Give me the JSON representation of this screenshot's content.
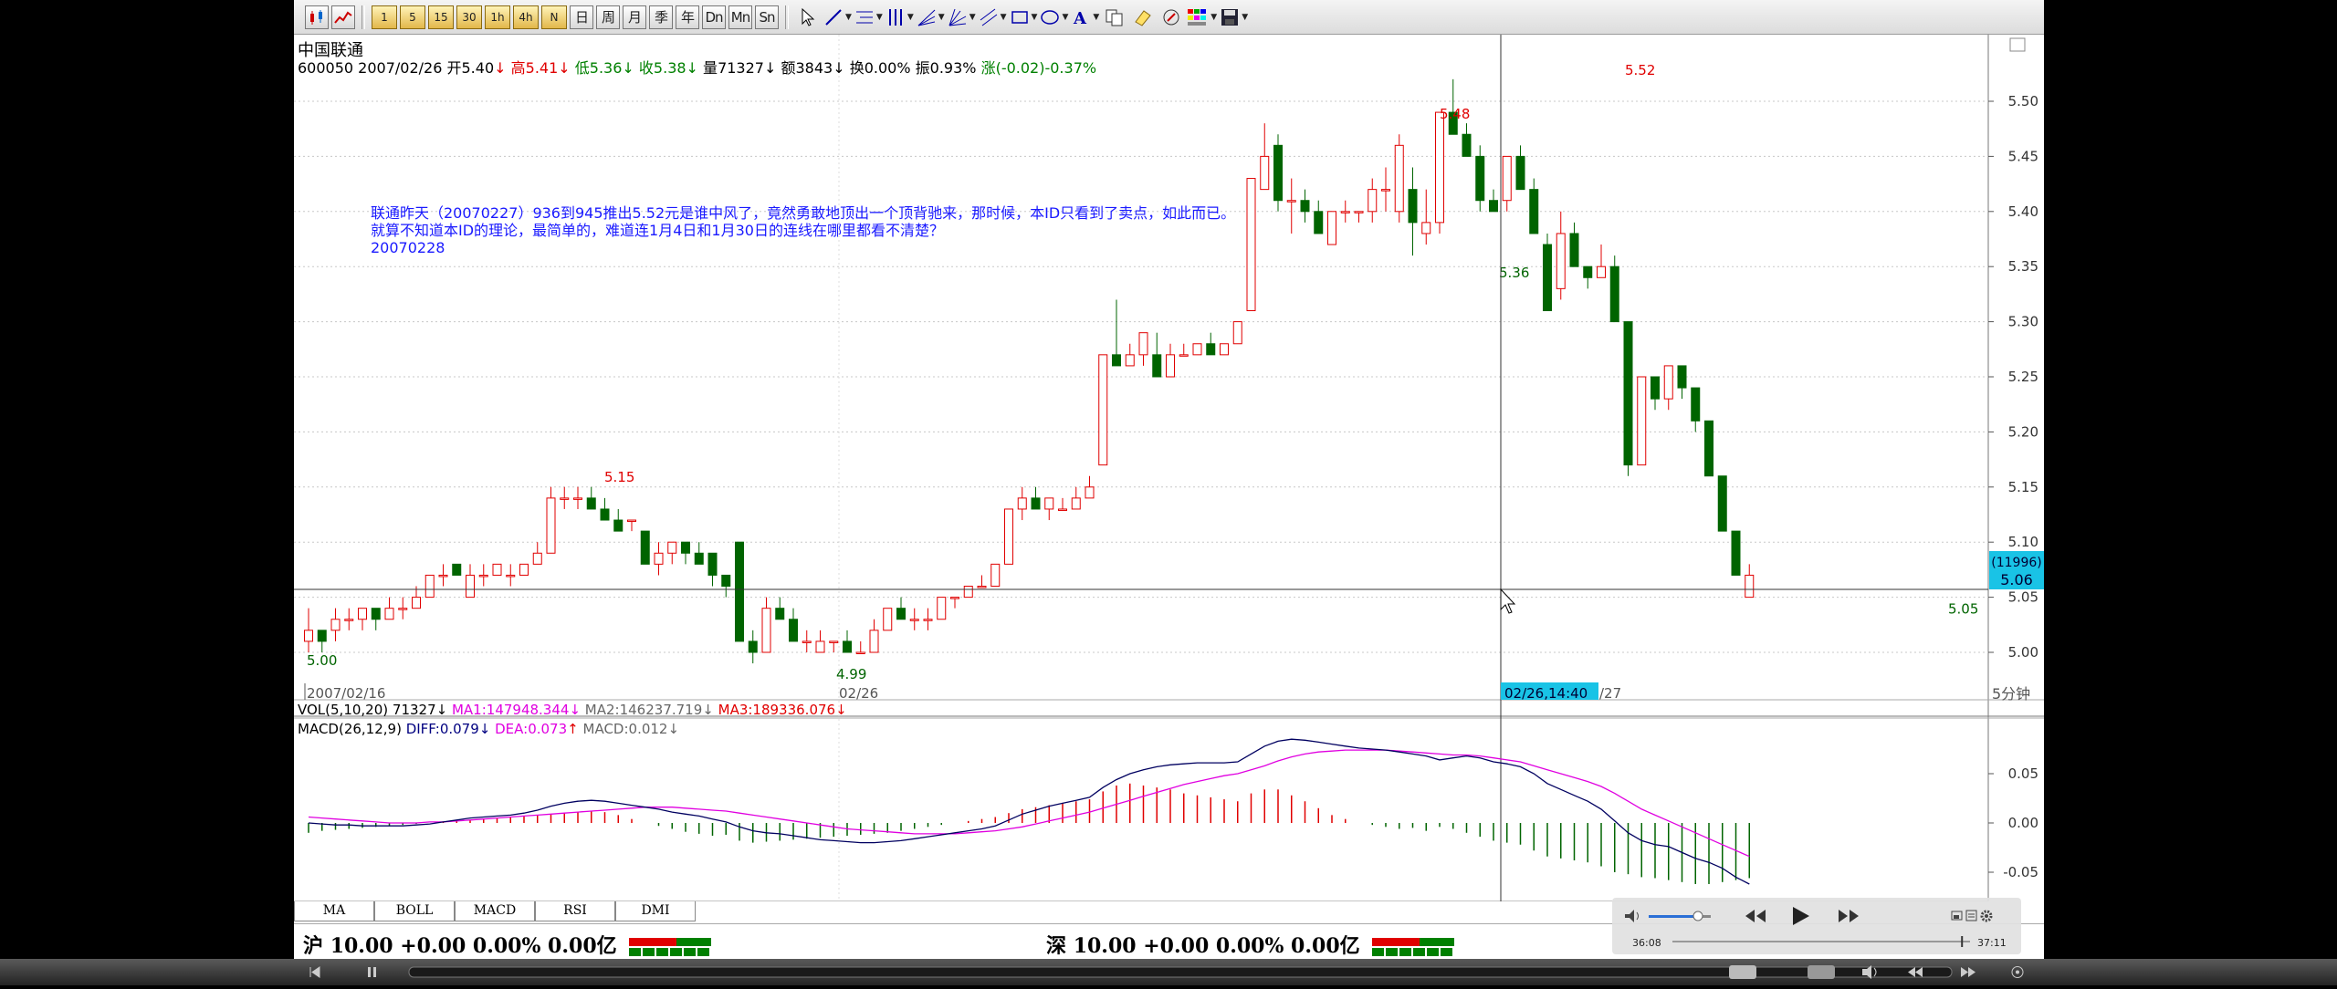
{
  "toolbar": {
    "buttons": [
      {
        "name": "candlestick-chart-icon",
        "label": ""
      },
      {
        "name": "line-chart-icon",
        "label": ""
      },
      {
        "name": "period-1min-button",
        "label": "1"
      },
      {
        "name": "period-5min-button",
        "label": "5"
      },
      {
        "name": "period-15min-button",
        "label": "15"
      },
      {
        "name": "period-30min-button",
        "label": "30"
      },
      {
        "name": "period-1h-button",
        "label": "1h"
      },
      {
        "name": "period-4h-button",
        "label": "4h"
      },
      {
        "name": "period-custom-button",
        "label": "N"
      },
      {
        "name": "period-day-button",
        "label": "日"
      },
      {
        "name": "period-week-button",
        "label": "周"
      },
      {
        "name": "period-month-button",
        "label": "月"
      },
      {
        "name": "period-quarter-button",
        "label": "季"
      },
      {
        "name": "period-year-button",
        "label": "年"
      },
      {
        "name": "period-dn-button",
        "label": "Dn"
      },
      {
        "name": "period-mn-button",
        "label": "Mn"
      },
      {
        "name": "period-sn-button",
        "label": "Sn"
      }
    ],
    "tools": [
      "cursor-icon",
      "line-tool-icon",
      "horizontal-line-tool-icon",
      "vertical-lines-tool-icon",
      "fan-tool-icon",
      "gann-fan-tool-icon",
      "parallel-lines-tool-icon",
      "rectangle-tool-icon",
      "ellipse-tool-icon",
      "text-tool-icon",
      "copy-icon",
      "eraser-icon",
      "brush-icon",
      "palette-icon",
      "save-icon"
    ]
  },
  "stock": {
    "name": "中国联通",
    "code": "600050",
    "date": "2007/02/26",
    "open_label": "开",
    "open": "5.40",
    "high_label": "高",
    "high": "5.41",
    "low_label": "低",
    "low": "5.36",
    "close_label": "收",
    "close": "5.38",
    "vol_label": "量",
    "vol": "71327",
    "amount_label": "额",
    "amount": "3843",
    "turnover_label": "换",
    "turnover": "0.00%",
    "amplitude_label": "振",
    "amplitude": "0.93%",
    "change_label": "涨",
    "change": "(-0.02)-0.37%"
  },
  "note": {
    "line1": "联通昨天（20070227）936到945推出5.52元是谁中风了，竟然勇敢地顶出一个顶背驰来，那时候，本ID只看到了卖点，如此而已。",
    "line2": "就算不知道本ID的理论，最简单的，难道连1月4日和1月30日的连线在哪里都看不清楚？",
    "line3": "20070228"
  },
  "price_axis": {
    "ticks": [
      "5.50",
      "5.45",
      "5.40",
      "5.35",
      "5.30",
      "5.25",
      "5.20",
      "5.15",
      "5.10",
      "5.05",
      "5.00"
    ],
    "cursor_qty": "(11996)",
    "cursor_price": "5.06"
  },
  "annotations": {
    "p515": "5.15",
    "p548": "5.48",
    "p552": "5.52",
    "p536": "5.36",
    "p500": "5.00",
    "p499": "4.99",
    "p505": "5.05"
  },
  "time_axis": {
    "left": "2007/02/16",
    "mid": "02/26",
    "cursor": "02/26,14:40",
    "right": "/27",
    "period": "5分钟"
  },
  "vol_line": {
    "label": "VOL(5,10,20)",
    "vol": "71327",
    "ma1": "MA1:147948.344",
    "ma2": "MA2:146237.719",
    "ma3": "MA3:189336.076"
  },
  "macd_line": {
    "label": "MACD(26,12,9)",
    "diff": "DIFF:0.079",
    "dea": "DEA:0.073",
    "macd": "MACD:0.012",
    "ticks": [
      "0.05",
      "0.00",
      "-0.05"
    ]
  },
  "indicator_tabs": [
    "MA",
    "BOLL",
    "MACD",
    "RSI",
    "DMI"
  ],
  "status": {
    "sh_label": "沪",
    "sh_value": "10.00 +0.00 0.00% 0.00亿",
    "sz_label": "深",
    "sz_value": "10.00 +0.00 0.00% 0.00亿"
  },
  "player": {
    "current_time": "36:08",
    "total_time": "37:11",
    "progress": 0.97
  },
  "colors": {
    "up": "#e00000",
    "down": "#006400",
    "note": "#1a1aff",
    "cursor_box": "#19c3e6",
    "dea": "#e000e0",
    "diff": "#000060"
  }
}
